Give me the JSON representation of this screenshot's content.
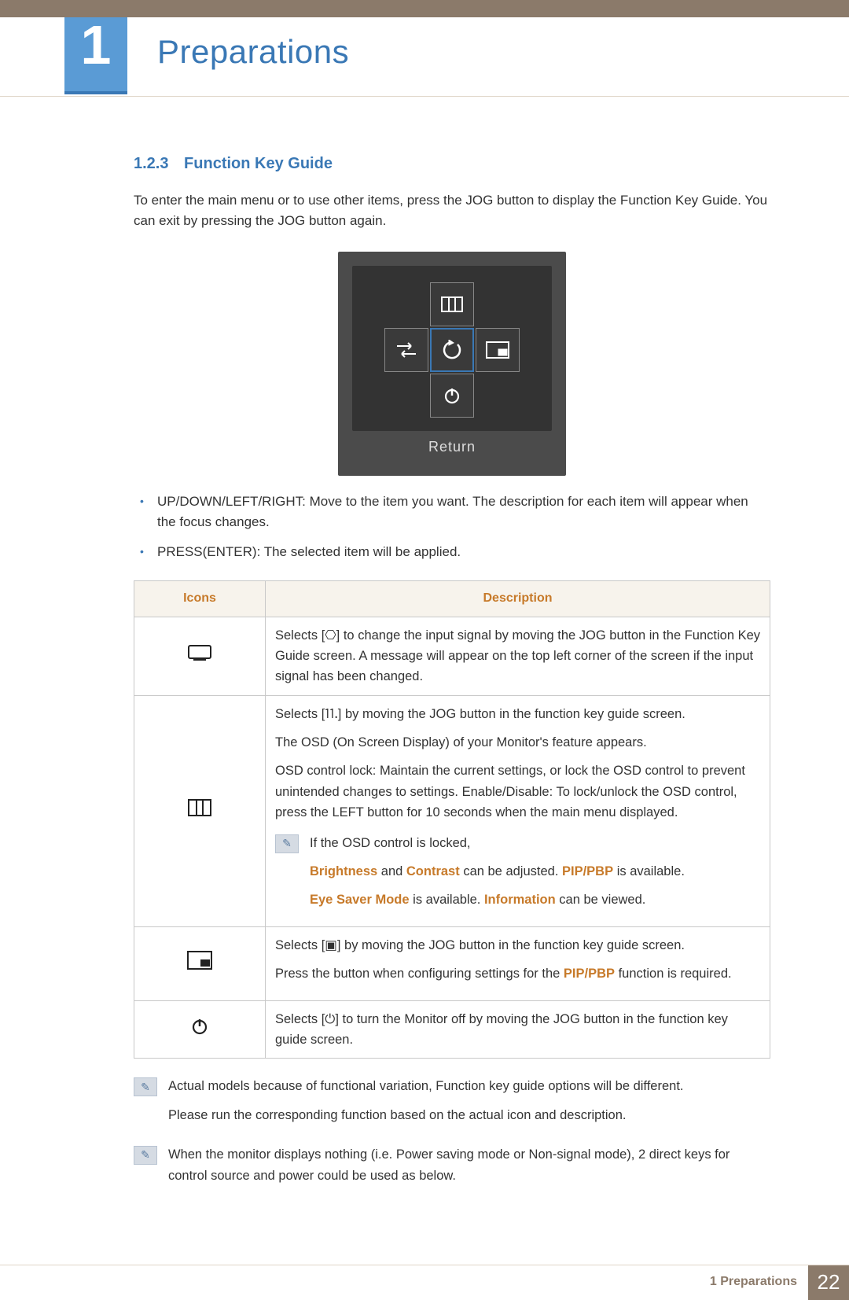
{
  "header": {
    "chapter_number": "1",
    "chapter_title": "Preparations"
  },
  "section": {
    "number": "1.2.3",
    "title": "Function Key Guide"
  },
  "intro": "To enter the main menu or to use other items, press the JOG button to display the Function Key Guide. You can exit by pressing the JOG button again.",
  "osd": {
    "return_label": "Return"
  },
  "bullets": [
    "UP/DOWN/LEFT/RIGHT: Move to the item you want. The description for each item will appear when the focus changes.",
    "PRESS(ENTER): The selected item will be applied."
  ],
  "table": {
    "headers": {
      "icons": "Icons",
      "description": "Description"
    },
    "rows": {
      "source": "Selects [⎔] to change the input signal by moving the JOG button in the Function Key Guide screen. A message will appear on the top left corner of the screen if the input signal has been changed.",
      "menu": {
        "p1": "Selects [⒒] by moving the JOG button in the function key guide screen.",
        "p2": "The OSD (On Screen Display) of your Monitor's feature appears.",
        "p3": "OSD control lock: Maintain the current settings, or lock the OSD control to prevent unintended changes to settings. Enable/Disable: To lock/unlock the OSD control, press the LEFT button for 10 seconds when the main menu displayed.",
        "note_intro": "If the OSD control is locked,",
        "note_a_pre": "Brightness",
        "note_a_mid": " and ",
        "note_a_mid2": "Contrast",
        "note_a_tail": " can be adjusted. ",
        "note_a_pip": "PIP/PBP",
        "note_a_end": " is available.",
        "note_b_pre": "Eye Saver Mode",
        "note_b_mid": " is available. ",
        "note_b_info": "Information",
        "note_b_end": " can be viewed."
      },
      "pip": {
        "p1": "Selects [▣] by moving the JOG button in the function key guide screen.",
        "p2_pre": "Press the button when configuring settings for the ",
        "p2_hi": "PIP/PBP",
        "p2_post": " function is required."
      },
      "power": "Selects [⏻] to turn the Monitor off by moving the JOG button in the function key guide screen."
    }
  },
  "notes": {
    "n1a": "Actual models because of functional variation, Function key guide options will be different.",
    "n1b": "Please run the corresponding function based on the actual icon and description.",
    "n2": "When the monitor displays nothing (i.e. Power saving mode or Non-signal mode), 2 direct keys for control source and power could be used as below."
  },
  "footer": {
    "label": "1 Preparations",
    "page": "22"
  }
}
